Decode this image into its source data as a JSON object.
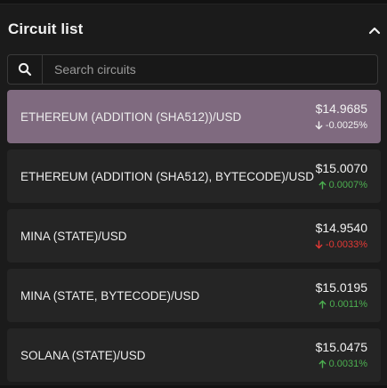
{
  "header": {
    "title": "Circuit list"
  },
  "search": {
    "placeholder": "Search circuits"
  },
  "circuits": [
    {
      "name": "ETHEREUM (ADDITION (SHA512))/USD",
      "price": "$14.9685",
      "change": "-0.0025%",
      "direction": "down",
      "selected": true
    },
    {
      "name": "ETHEREUM (ADDITION (SHA512), BYTECODE)/USD",
      "price": "$15.0070",
      "change": "0.0007%",
      "direction": "up",
      "selected": false
    },
    {
      "name": "MINA (STATE)/USD",
      "price": "$14.9540",
      "change": "-0.0033%",
      "direction": "down",
      "selected": false
    },
    {
      "name": "MINA (STATE, BYTECODE)/USD",
      "price": "$15.0195",
      "change": "0.0011%",
      "direction": "up",
      "selected": false
    },
    {
      "name": "SOLANA (STATE)/USD",
      "price": "$15.0475",
      "change": "0.0031%",
      "direction": "up",
      "selected": false
    }
  ],
  "icons": {
    "search": "search-icon",
    "collapse": "chevron-up-icon",
    "up": "arrow-up-icon",
    "down": "arrow-down-icon"
  },
  "colors": {
    "selected_row": "#7f6a7f",
    "up": "#4caf50",
    "down": "#e53935"
  }
}
